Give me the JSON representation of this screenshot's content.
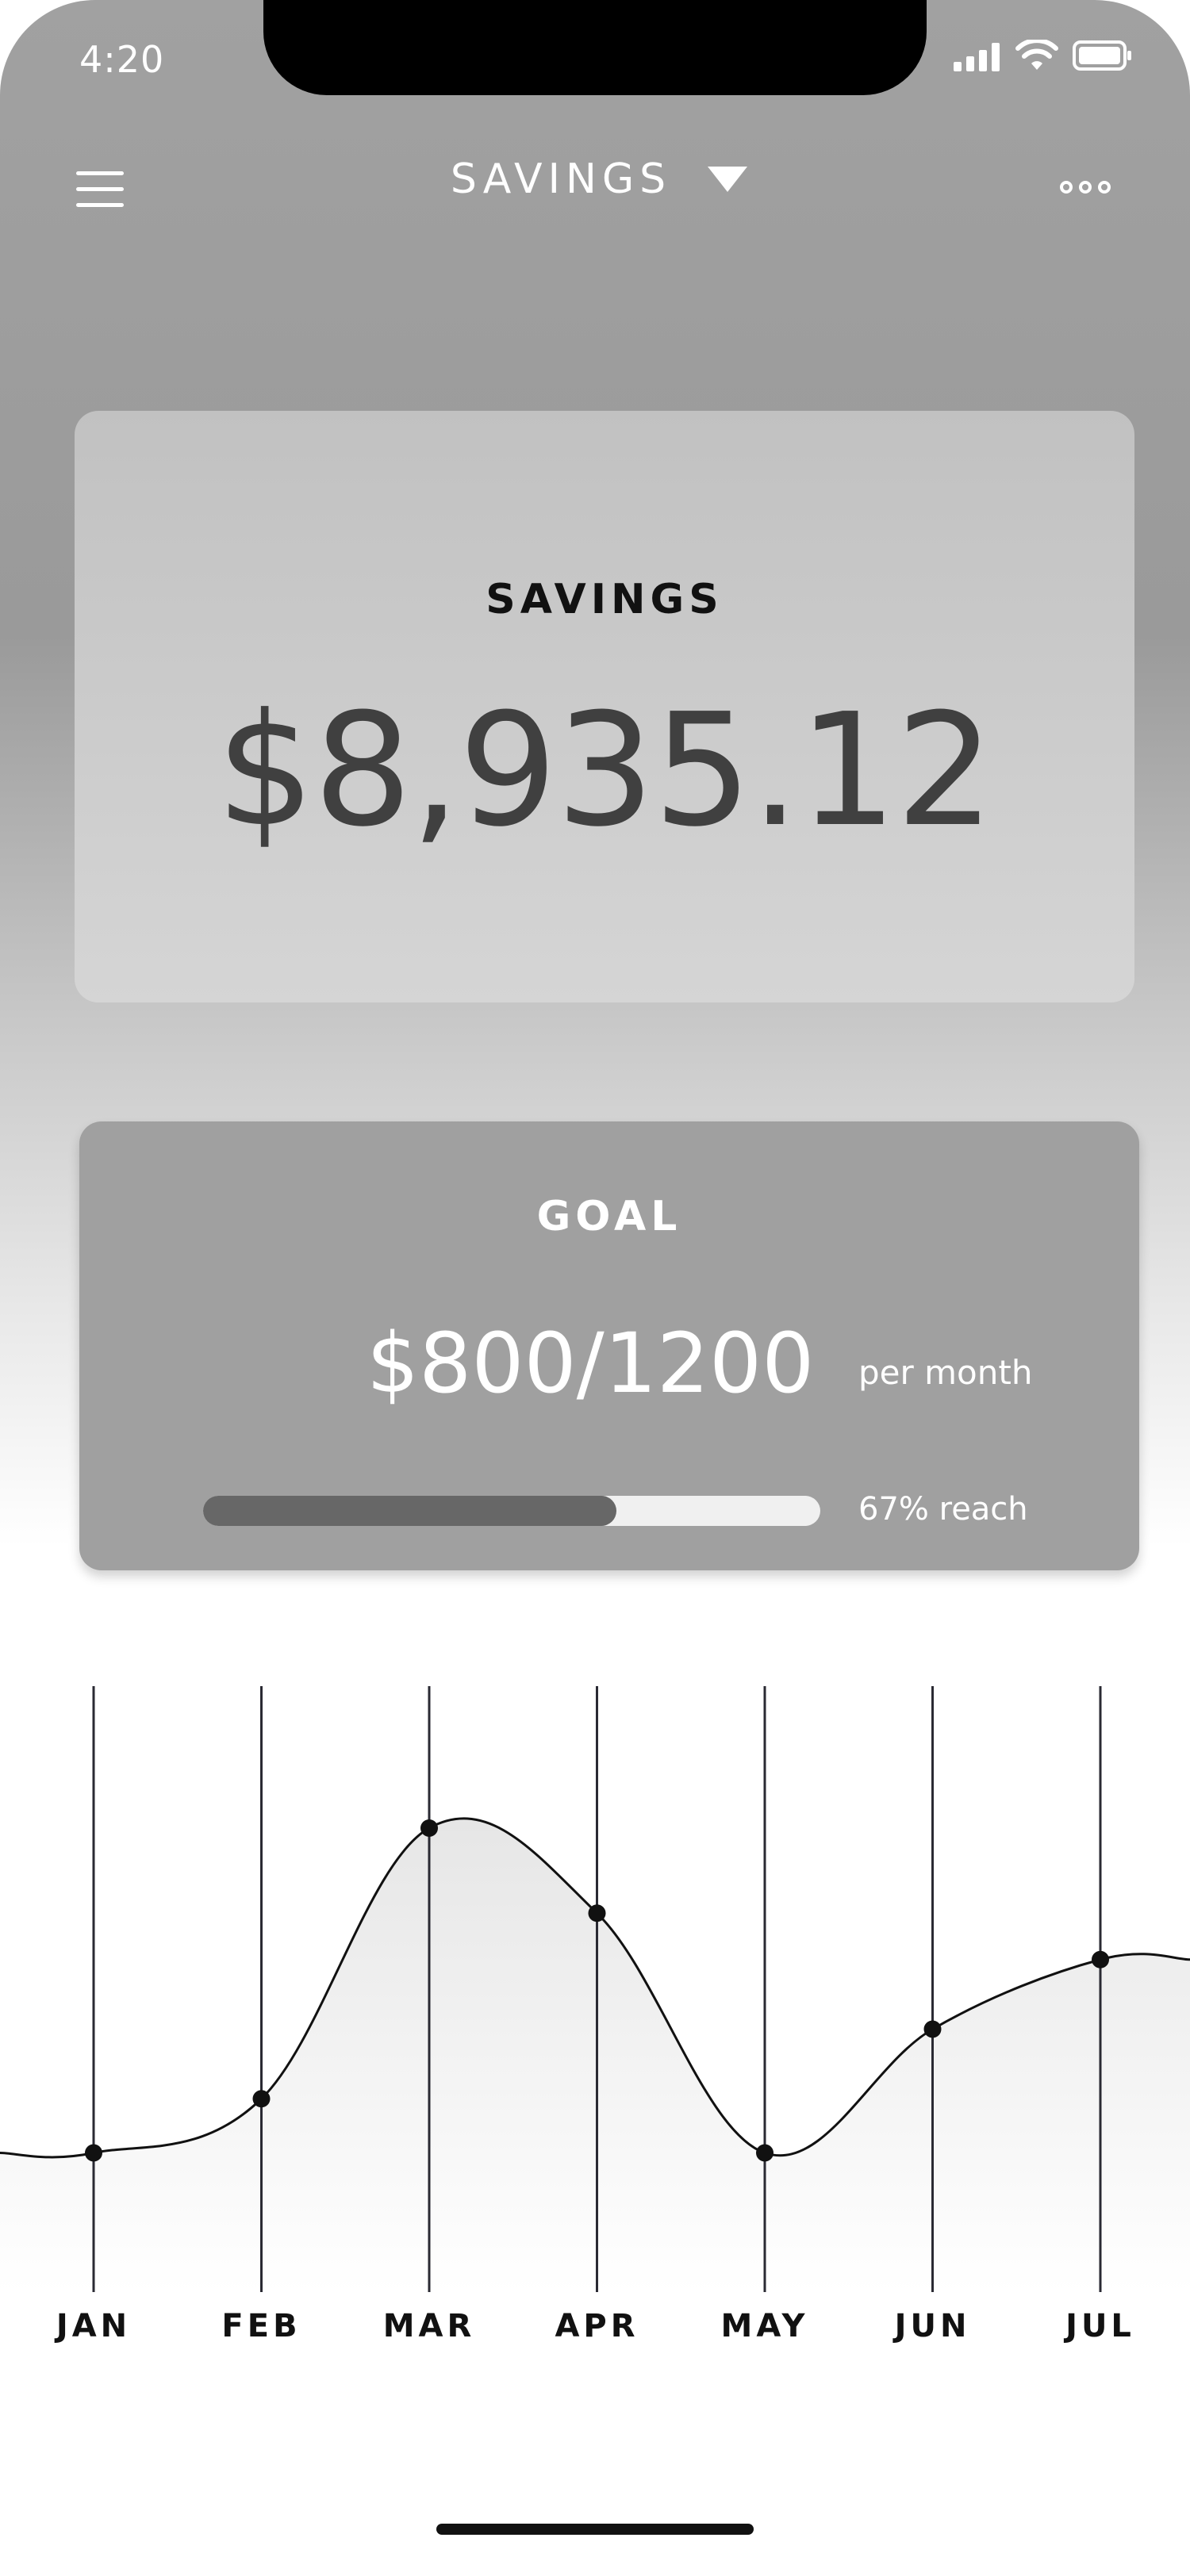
{
  "status_bar": {
    "time": "4:20"
  },
  "header": {
    "title": "SAVINGS"
  },
  "savings_card": {
    "label": "SAVINGS",
    "amount": "$8,935.12"
  },
  "goal_card": {
    "label": "GOAL",
    "amount": "$800/1200",
    "unit": "per month",
    "progress_fraction": 0.67,
    "progress_text": "67% reach"
  },
  "colors": {
    "progress_fill": "#676767",
    "progress_track": "#f0f0f0",
    "chart_line": "#111111"
  },
  "chart_data": {
    "type": "area",
    "categories": [
      "JAN",
      "FEB",
      "MAR",
      "APR",
      "MAY",
      "JUN",
      "JUL"
    ],
    "values": [
      18,
      25,
      60,
      49,
      18,
      34,
      43
    ],
    "ylim": [
      0,
      80
    ],
    "grid": "vertical"
  }
}
